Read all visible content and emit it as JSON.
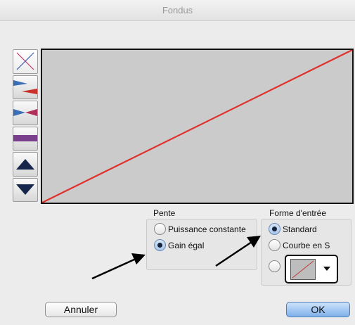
{
  "window": {
    "title": "Fondus"
  },
  "toolbar": {
    "buttons": [
      {
        "icon": "crossfade-x-icon",
        "selected": true
      },
      {
        "icon": "fade-out-wedge-icon",
        "selected": false
      },
      {
        "icon": "fade-bowtie-icon",
        "selected": false
      },
      {
        "icon": "flat-fade-icon",
        "selected": false
      },
      {
        "icon": "arrow-up-icon",
        "selected": false
      },
      {
        "icon": "arrow-down-icon",
        "selected": false
      }
    ]
  },
  "pente": {
    "title": "Pente",
    "options": [
      {
        "label": "Puissance constante",
        "checked": false
      },
      {
        "label": "Gain égal",
        "checked": true
      }
    ]
  },
  "forme": {
    "title": "Forme d'entrée",
    "options": [
      {
        "label": "Standard",
        "checked": true
      },
      {
        "label": "Courbe en S",
        "checked": false
      },
      {
        "label": "",
        "checked": false
      }
    ]
  },
  "buttons": {
    "cancel": "Annuler",
    "ok": "OK"
  },
  "colors": {
    "curve": "#e0302c",
    "accent": "#7fb0ea",
    "arrow": "#000000"
  }
}
